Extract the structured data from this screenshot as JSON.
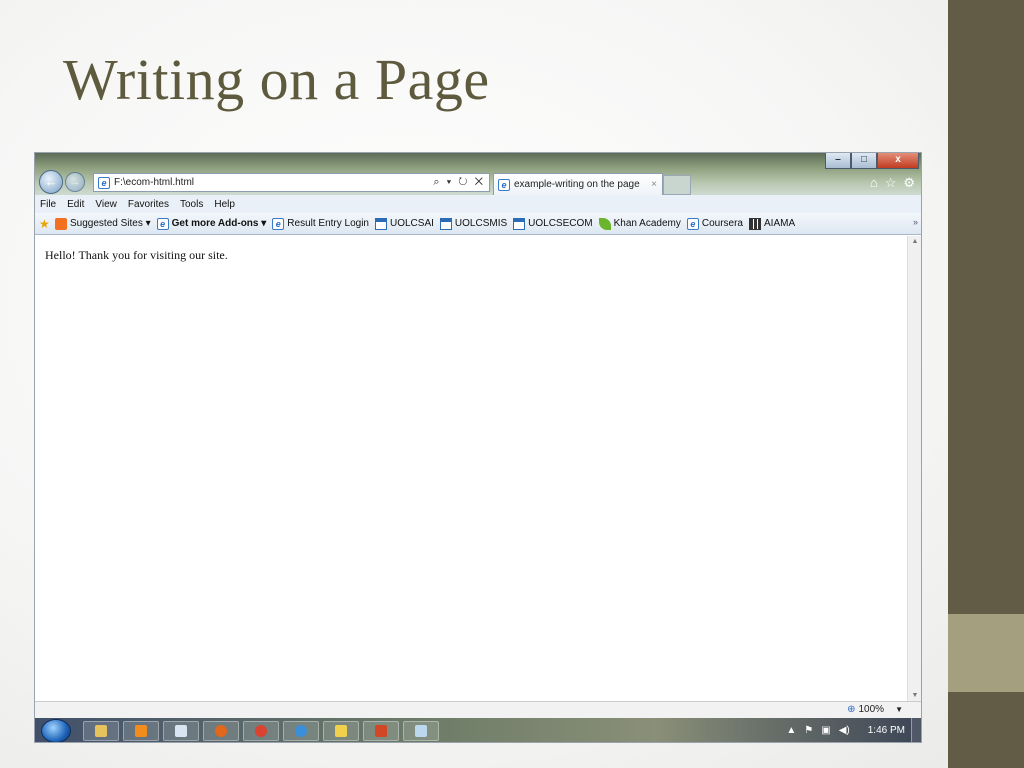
{
  "slide": {
    "title": "Writing on a Page"
  },
  "browser": {
    "window_controls": {
      "minimize": "–",
      "maximize": "□",
      "close": "x"
    },
    "address": "F:\\ecom-html.html",
    "address_tools": "⌕ ▾ ↻ ✕",
    "tab_title": "example-writing on the page",
    "tab_close": "×",
    "menu": [
      "File",
      "Edit",
      "View",
      "Favorites",
      "Tools",
      "Help"
    ],
    "favorites": [
      {
        "label": "Suggested Sites ▾",
        "icon": "suggest-icon",
        "bold": false
      },
      {
        "label": "Get more Add-ons ▾",
        "icon": "ie-icon",
        "bold": true
      },
      {
        "label": "Result Entry Login",
        "icon": "ie-icon",
        "bold": false
      },
      {
        "label": "UOLCSAI",
        "icon": "window-icon",
        "bold": false
      },
      {
        "label": "UOLCSMIS",
        "icon": "window-icon",
        "bold": false
      },
      {
        "label": "UOLCSECOM",
        "icon": "window-icon",
        "bold": false
      },
      {
        "label": "Khan Academy",
        "icon": "leaf-icon",
        "bold": false
      },
      {
        "label": "Coursera",
        "icon": "ie-icon",
        "bold": false
      },
      {
        "label": "AIAMA",
        "icon": "grid-icon",
        "bold": false
      }
    ],
    "favorites_more": "»",
    "page_text": "Hello! Thank you for visiting our site.",
    "zoom": "100%",
    "zoom_arrow": "▼"
  },
  "taskbar": {
    "items": [
      {
        "name": "explorer",
        "color": "#e6c35c"
      },
      {
        "name": "media-player",
        "color": "#f28c1c"
      },
      {
        "name": "document",
        "color": "#d9e6f2"
      },
      {
        "name": "firefox",
        "color": "#e0671b"
      },
      {
        "name": "chrome",
        "color": "#d9432f"
      },
      {
        "name": "internet-explorer",
        "color": "#3b8fd9"
      },
      {
        "name": "paint",
        "color": "#f0d04c"
      },
      {
        "name": "powerpoint",
        "color": "#d24726"
      },
      {
        "name": "notepad",
        "color": "#bcd8ef"
      }
    ],
    "tray_arrow": "▲",
    "clock": "1:46 PM"
  }
}
